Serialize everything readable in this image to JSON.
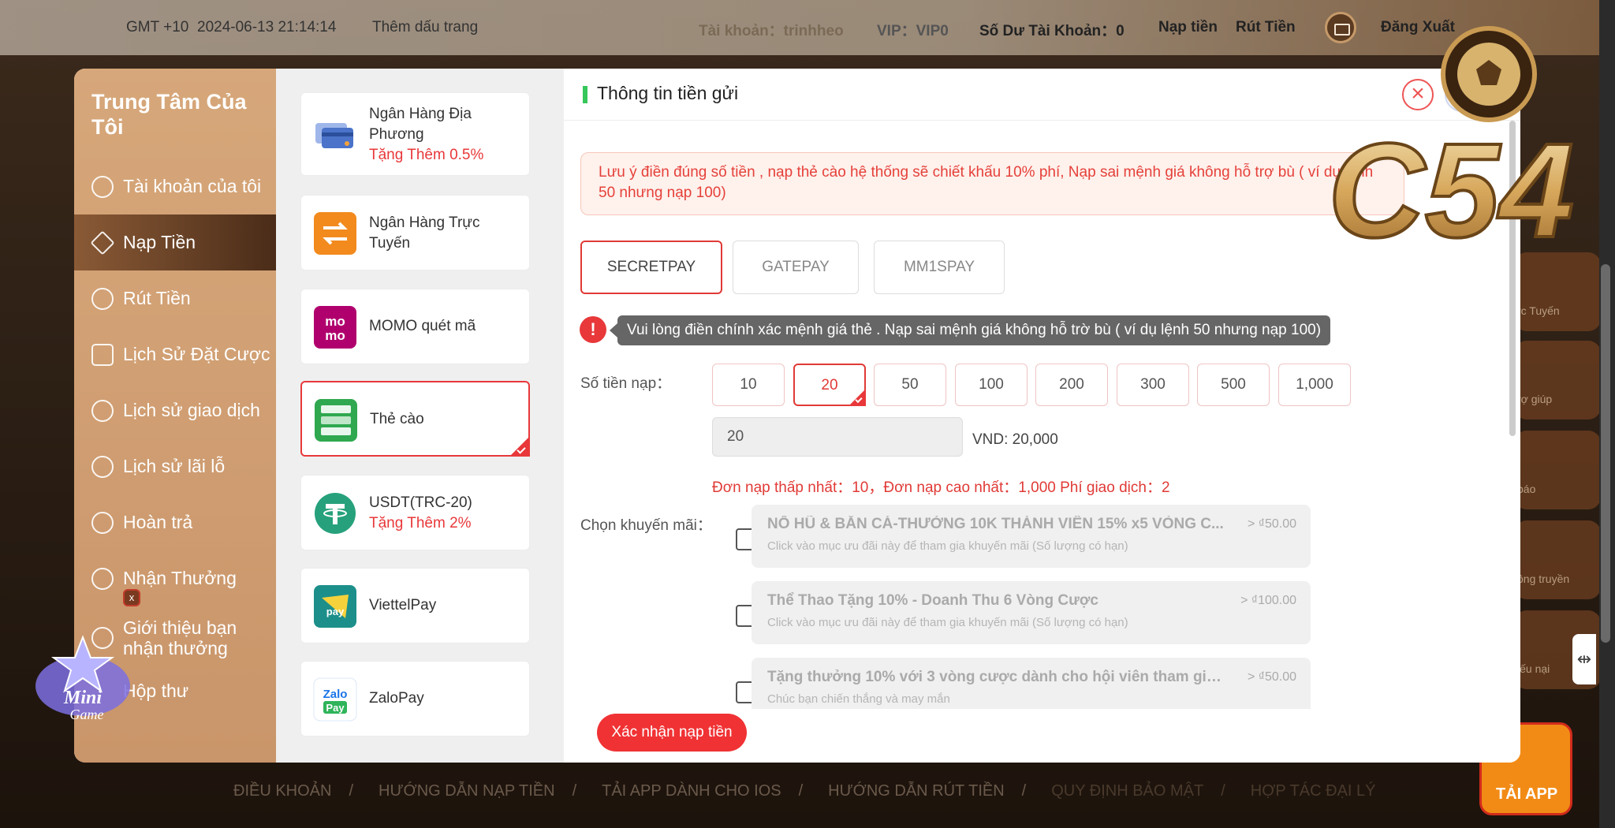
{
  "topbar": {
    "timezone": "GMT +10",
    "datetime": "2024-06-13 21:14:14",
    "bookmark": "Thêm dấu trang",
    "account": "Tài khoản：trinhheo",
    "vip": "VIP：VIP0",
    "balance": "Số Dư Tài Khoản：0",
    "deposit": "Nạp tiền",
    "withdraw": "Rút Tiền",
    "logout": "Đăng Xuất"
  },
  "nav": {
    "title": "Trung Tâm Của Tôi",
    "items": [
      {
        "label": "Tài khoản của tôi"
      },
      {
        "label": "Nạp Tiền"
      },
      {
        "label": "Rút Tiền"
      },
      {
        "label": "Lịch Sử Đặt Cược"
      },
      {
        "label": "Lịch sử giao dịch"
      },
      {
        "label": "Lịch sử lãi lỗ"
      },
      {
        "label": "Hoàn trả"
      },
      {
        "label": "Nhận Thưởng"
      },
      {
        "label": "Giới thiệu bạn nhận thưởng"
      },
      {
        "label": "Hộp thư"
      }
    ],
    "badge": "x",
    "active_index": 1
  },
  "methods": [
    {
      "name": "Ngân Hàng Địa Phương",
      "bonus": "Tặng Thêm 0.5%",
      "icon": "bank-card-icon",
      "color": "#4a73c9"
    },
    {
      "name": "Ngân Hàng Trực Tuyến",
      "bonus": "",
      "icon": "bank-transfer-icon",
      "color": "#f28a1e"
    },
    {
      "name": "MOMO quét mã",
      "bonus": "",
      "icon": "momo-icon",
      "color": "#b0006d"
    },
    {
      "name": "Thẻ cào",
      "bonus": "",
      "icon": "scratch-card-icon",
      "color": "#2fa84f"
    },
    {
      "name": "USDT(TRC-20)",
      "bonus": "Tặng Thêm 2%",
      "icon": "tether-icon",
      "color": "#26a17b"
    },
    {
      "name": "ViettelPay",
      "bonus": "",
      "icon": "viettelpay-icon",
      "color": "#1d8f8a"
    },
    {
      "name": "ZaloPay",
      "bonus": "",
      "icon": "zalopay-icon",
      "color": "#1a75e8"
    }
  ],
  "content": {
    "title": "Thông tin tiền gửi",
    "notice": "Lưu ý điền đúng số tiền , nạp thẻ cào hệ thống sẽ chiết khấu 10% phí, Nạp sai mệnh giá không hỗ trợ bù ( ví dụ lệnh 50 nhưng nạp 100)",
    "gateways": [
      "SECRETPAY",
      "GATEPAY",
      "MM1SPAY"
    ],
    "tooltip": "Vui lòng điền chính xác mệnh giá thẻ . Nạp sai mệnh giá không hỗ trờ bù ( ví dụ lệnh 50 nhưng nạp 100)",
    "amount_label": "Số tiền nạp：",
    "amounts": [
      "10",
      "20",
      "50",
      "100",
      "200",
      "300",
      "500",
      "1,000"
    ],
    "amount_value": "20",
    "vnd": "VND: 20,000",
    "limits": "Đơn nạp thấp nhất：10，Đơn nạp cao nhất：1,000  Phí giao dịch：2",
    "promo_label": "Chọn khuyến mãi：",
    "promos": [
      {
        "title": "NỔ HŨ & BẮN CÁ-THƯỞNG 10K THÀNH VIÊN 15% x5 VÒNG C...",
        "sub": "Click vào mục ưu đãi này để tham gia khuyến mãi (Số lượng có hạn)",
        "amount": "> ₫50.00"
      },
      {
        "title": "Thể Thao Tặng 10% - Doanh Thu 6 Vòng Cược",
        "sub": "Click vào mục ưu đãi này để tham gia khuyến mãi (Số lượng có hạn)",
        "amount": "> ₫100.00"
      },
      {
        "title": "Tặng thưởng 10% với 3 vòng cược dành cho hội viên tham gia Mi...",
        "sub": "Chúc bạn chiến thắng và may mắn",
        "amount": "> ₫50.00"
      }
    ],
    "submit": "Xác nhận nạp tiền"
  },
  "footer": [
    "ĐIỀU KHOẢN",
    "HƯỚNG DẪN NẠP TIỀN",
    "TẢI APP DÀNH CHO IOS",
    "HƯỚNG DẪN RÚT TIỀN",
    "QUY ĐỊNH BẢO MẬT",
    "HỢP TÁC ĐẠI LÝ"
  ],
  "side": {
    "tiles": [
      "rc Tuyến",
      "rợ giúp",
      "báo",
      "ông truyền",
      "iếu nại"
    ],
    "app": "TẢI APP"
  },
  "logo_text": "C54",
  "accent": "#e8383a"
}
